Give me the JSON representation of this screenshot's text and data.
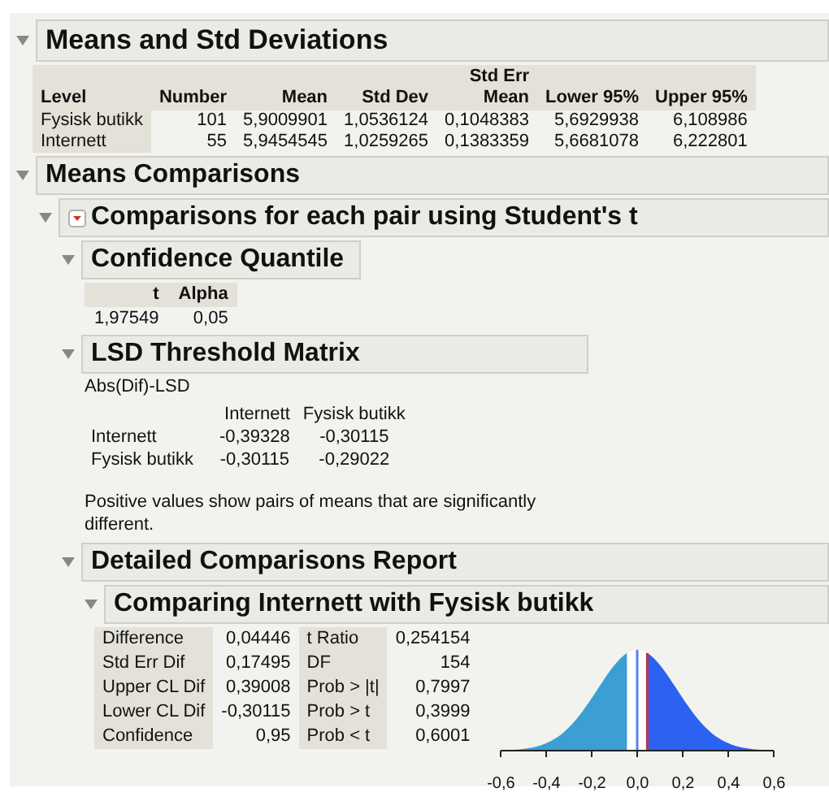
{
  "means_section": {
    "title": "Means and Std Deviations",
    "expanded": true,
    "columns": [
      {
        "line2": "Level"
      },
      {
        "line2": "Number"
      },
      {
        "line2": "Mean"
      },
      {
        "line2": "Std Dev"
      },
      {
        "line1": "Std Err",
        "line2": "Mean"
      },
      {
        "line2": "Lower 95%"
      },
      {
        "line2": "Upper 95%"
      }
    ],
    "rows": [
      [
        "Fysisk butikk",
        "101",
        "5,9009901",
        "1,0536124",
        "0,1048383",
        "5,6929938",
        "6,108986"
      ],
      [
        "Internett",
        "55",
        "5,9454545",
        "1,0259265",
        "0,1383359",
        "5,6681078",
        "6,222801"
      ]
    ]
  },
  "comparisons_section": {
    "title": "Means Comparisons",
    "expanded": true,
    "pair_section": {
      "title": "Comparisons for each pair using Student's t",
      "expanded": true,
      "quantile": {
        "title": "Confidence Quantile",
        "expanded": true,
        "columns": [
          "t",
          "Alpha"
        ],
        "values": [
          "1,97549",
          "0,05"
        ]
      },
      "lsd": {
        "title": "LSD Threshold Matrix",
        "expanded": true,
        "caption": "Abs(Dif)-LSD",
        "columns": [
          "Internett",
          "Fysisk butikk"
        ],
        "rows": [
          {
            "label": "Internett",
            "values": [
              "-0,39328",
              "-0,30115"
            ]
          },
          {
            "label": "Fysisk butikk",
            "values": [
              "-0,30115",
              "-0,29022"
            ]
          }
        ],
        "note": "Positive values show pairs of means that are significantly different."
      },
      "detailed": {
        "title": "Detailed Comparisons Report",
        "expanded": true,
        "comparing": {
          "title": "Comparing Internett with Fysisk butikk",
          "expanded": true,
          "left": [
            {
              "label": "Difference",
              "value": "0,04446"
            },
            {
              "label": "Std Err Dif",
              "value": "0,17495"
            },
            {
              "label": "Upper CL Dif",
              "value": "0,39008"
            },
            {
              "label": "Lower CL Dif",
              "value": "-0,30115"
            },
            {
              "label": "Confidence",
              "value": "0,95"
            }
          ],
          "right": [
            {
              "label": "t Ratio",
              "value": "0,254154"
            },
            {
              "label": "DF",
              "value": "154"
            },
            {
              "label": "Prob > |t|",
              "value": "0,7997"
            },
            {
              "label": "Prob > t",
              "value": "0,3999"
            },
            {
              "label": "Prob < t",
              "value": "0,6001"
            }
          ],
          "axis_ticks": [
            "-0,6",
            "-0,4",
            "-0,2",
            "0,0",
            "0,2",
            "0,4",
            "0,6"
          ]
        }
      }
    }
  }
}
